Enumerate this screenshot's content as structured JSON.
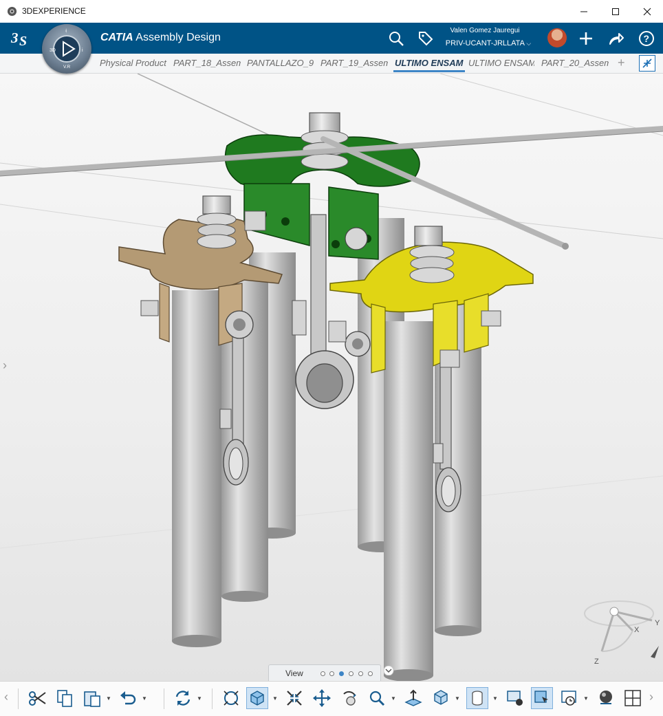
{
  "window": {
    "title": "3DEXPERIENCE",
    "controls": [
      "minimize",
      "maximize",
      "close"
    ]
  },
  "header": {
    "brand": "CATIA",
    "app_name": "Assembly Design",
    "compass_label": "V.R",
    "compass_3d": "3D",
    "user": {
      "name": "Valen Gomez Jauregui",
      "tenant": "PRIV-UCANT-JRLLATA"
    },
    "icons": [
      "search-icon",
      "tag-icon",
      "add-icon",
      "share-icon",
      "help-icon"
    ]
  },
  "tabs": [
    {
      "label": "Physical Product",
      "active": false
    },
    {
      "label": "PART_18_Assem",
      "active": false
    },
    {
      "label": "PANTALLAZO_9",
      "active": false
    },
    {
      "label": "PART_19_Assem",
      "active": false
    },
    {
      "label": "ULTIMO ENSAM",
      "active": true
    },
    {
      "label": "ULTIMO ENSAM",
      "active": false
    },
    {
      "label": "PART_20_Assem",
      "active": false
    }
  ],
  "tab_add": "+",
  "viewport": {
    "compass_axes": [
      "X",
      "Y",
      "Z"
    ],
    "part_colors": {
      "green": "#1f7a1f",
      "tan": "#b49a74",
      "yellow": "#e0d514",
      "gray": "#c4c4c4"
    }
  },
  "section_bar": {
    "label": "View",
    "dots": 6,
    "active_dot": 3
  },
  "actionbar": {
    "tools": [
      "cut-icon",
      "copy-icon",
      "paste-icon",
      "undo-icon",
      "update-icon",
      "fit-all-icon",
      "view-cube-icon",
      "pan-icon",
      "move-icon",
      "rotate-icon",
      "zoom-icon",
      "normal-view-icon",
      "render-style-icon",
      "cylinder-icon",
      "capture-icon",
      "selection-mode-icon",
      "timeline-icon",
      "material-icon",
      "layout-icon"
    ]
  }
}
